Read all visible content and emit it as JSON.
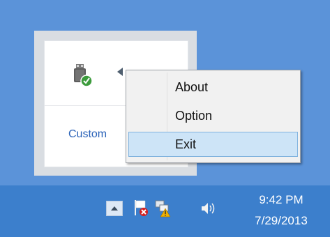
{
  "flyout": {
    "customize_label": "Custom",
    "icons": [
      "usb-safely-remove-icon",
      "hidden-arrow-icon"
    ]
  },
  "context_menu": {
    "items": [
      {
        "label": "About"
      },
      {
        "label": "Option"
      },
      {
        "label": "Exit",
        "selected": true
      }
    ]
  },
  "taskbar": {
    "clock": {
      "time": "9:42 PM",
      "date": "7/29/2013"
    },
    "tray_icons": [
      "show-hidden-icons-button",
      "action-center-icon",
      "network-icon",
      "volume-icon"
    ]
  },
  "colors": {
    "desktop": "#5b93d9",
    "taskbar": "#3c7fcc",
    "menu_selected_bg": "#cde4f7",
    "menu_selected_border": "#7fb2de",
    "link": "#2a62b8"
  }
}
